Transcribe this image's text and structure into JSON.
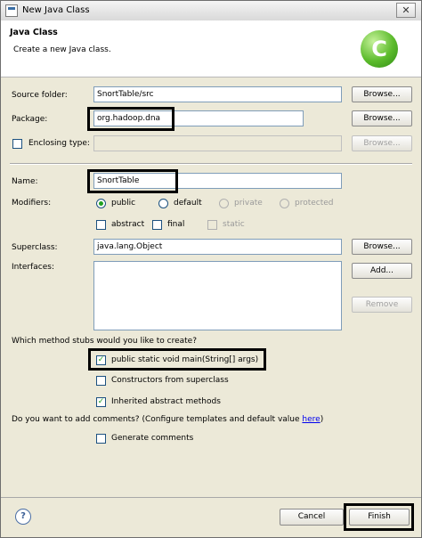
{
  "window": {
    "title": "New Java Class",
    "close_glyph": "✕"
  },
  "banner": {
    "title": "Java Class",
    "description": "Create a new Java class.",
    "logo_letter": "C",
    "logo_color": "#5cbb2c"
  },
  "source_folder": {
    "label": "Source folder:",
    "value": "SnortTable/src",
    "button": "Browse..."
  },
  "package": {
    "label": "Package:",
    "value": "org.hadoop.dna",
    "button": "Browse..."
  },
  "enclosing_type": {
    "label": "Enclosing type:",
    "checked": false,
    "value": "",
    "button": "Browse..."
  },
  "name": {
    "label": "Name:",
    "value": "SnortTable"
  },
  "modifiers": {
    "label": "Modifiers:",
    "radios": [
      {
        "label": "public",
        "selected": true,
        "enabled": true
      },
      {
        "label": "default",
        "selected": false,
        "enabled": true
      },
      {
        "label": "private",
        "selected": false,
        "enabled": false
      },
      {
        "label": "protected",
        "selected": false,
        "enabled": false
      }
    ],
    "checks": [
      {
        "label": "abstract",
        "checked": false,
        "enabled": true
      },
      {
        "label": "final",
        "checked": false,
        "enabled": true
      },
      {
        "label": "static",
        "checked": false,
        "enabled": false
      }
    ]
  },
  "superclass": {
    "label": "Superclass:",
    "value": "java.lang.Object",
    "button": "Browse..."
  },
  "interfaces": {
    "label": "Interfaces:",
    "add_button": "Add...",
    "remove_button": "Remove"
  },
  "stubs": {
    "question": "Which method stubs would you like to create?",
    "options": [
      {
        "label": "public static void main(String[] args)",
        "checked": true
      },
      {
        "label": "Constructors from superclass",
        "checked": false
      },
      {
        "label": "Inherited abstract methods",
        "checked": true
      }
    ]
  },
  "comments": {
    "question": "Do you want to add comments? (Configure templates and default value",
    "link": "here",
    "suffix": ")",
    "option": {
      "label": "Generate comments",
      "checked": false
    }
  },
  "footer": {
    "help_glyph": "?",
    "cancel": "Cancel",
    "finish": "Finish"
  },
  "check_glyph": "✓"
}
